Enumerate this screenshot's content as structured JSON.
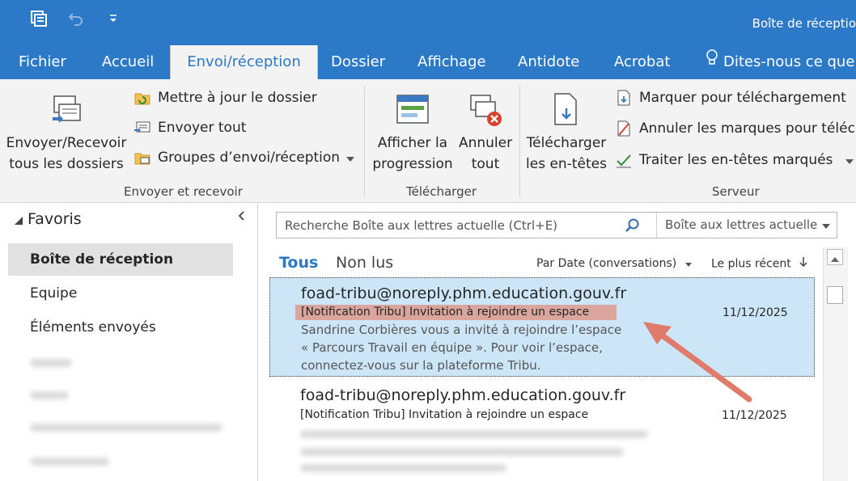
{
  "titlebar": {
    "title": "Boîte de réceptio"
  },
  "tabs": [
    {
      "label": "Fichier"
    },
    {
      "label": "Accueil"
    },
    {
      "label": "Envoi/réception"
    },
    {
      "label": "Dossier"
    },
    {
      "label": "Affichage"
    },
    {
      "label": "Antidote"
    },
    {
      "label": "Acrobat"
    }
  ],
  "tell_me": "Dites-nous ce que v",
  "ribbon": {
    "send_receive_all": "Envoyer/Recevoir tous les dossiers",
    "update_folder": "Mettre à jour le dossier",
    "send_all": "Envoyer tout",
    "groups": "Groupes d’envoi/réception",
    "group_send_receive": "Envoyer et recevoir",
    "show_progress": "Afficher la progression",
    "cancel_all": "Annuler tout",
    "group_download": "Télécharger",
    "download_headers": "Télécharger les en-têtes",
    "mark_download": "Marquer pour téléchargement",
    "unmark": "Annuler les marques pour téléch",
    "process_headers": "Traiter les en-têtes marqués",
    "group_server": "Serveur"
  },
  "folders": {
    "favorites": "Favoris",
    "inbox": "Boîte de réception",
    "equipe": "Equipe",
    "sent": "Éléments envoyés"
  },
  "search": {
    "placeholder": "Recherche Boîte aux lettres actuelle (Ctrl+E)",
    "scope": "Boîte aux lettres actuelle"
  },
  "filters": {
    "all": "Tous",
    "unread": "Non lus"
  },
  "sort": {
    "by": "Par Date (conversations)",
    "order": "Le plus récent"
  },
  "emails": [
    {
      "sender": "foad-tribu@noreply.phm.education.gouv.fr",
      "subject": "[Notification Tribu] Invitation à rejoindre un espace",
      "date": "11/12/2025",
      "preview": [
        "Sandrine Corbières vous a invité à rejoindre l’espace",
        "« Parcours Travail en équipe ». Pour voir l’espace,",
        "connectez-vous sur la plateforme Tribu."
      ]
    },
    {
      "sender": "foad-tribu@noreply.phm.education.gouv.fr",
      "subject": "[Notification Tribu] Invitation à rejoindre un espace",
      "date": "11/12/2025"
    }
  ],
  "colors": {
    "accent": "#2b79c7",
    "selected_row": "#cde6f7",
    "highlight": "#d9a59c",
    "arrow": "#e07a6a"
  }
}
